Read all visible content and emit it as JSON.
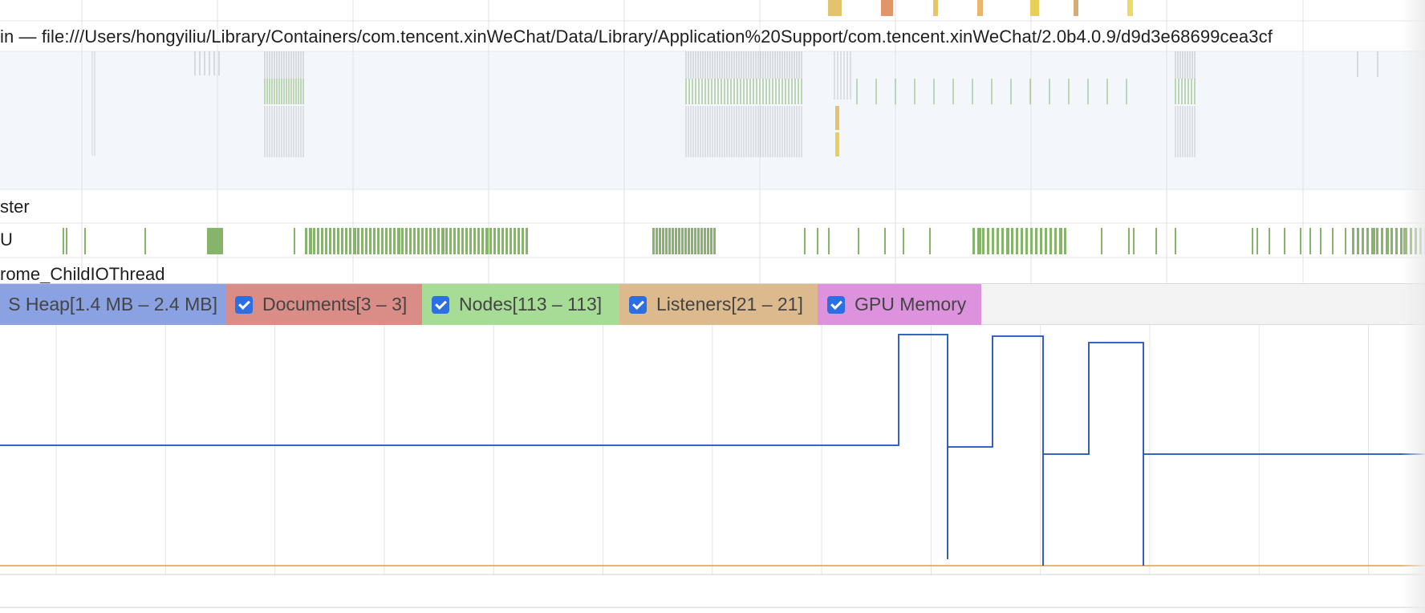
{
  "tracks": {
    "main_url": "in — file:///Users/hongyiliu/Library/Containers/com.tencent.xinWeChat/Data/Library/Application%20Support/com.tencent.xinWeChat/2.0b4.0.9/d9d3e68699cea3cf",
    "raster": "ster",
    "gpu": "U",
    "childio": "rome_ChildIOThread"
  },
  "counters": [
    {
      "key": "jsheap",
      "label": "S Heap[1.4 MB – 2.4 MB]",
      "checked": true,
      "color": "#8aa2e2"
    },
    {
      "key": "documents",
      "label": "Documents[3 – 3]",
      "checked": true,
      "color": "#da8d86"
    },
    {
      "key": "nodes",
      "label": "Nodes[113 – 113]",
      "checked": true,
      "color": "#a6dc96"
    },
    {
      "key": "listeners",
      "label": "Listeners[21 – 21]",
      "checked": true,
      "color": "#dcba8e"
    },
    {
      "key": "gpu",
      "label": "GPU Memory",
      "checked": true,
      "color": "#dc92dc"
    }
  ],
  "colors": {
    "jsheap_line": "#1f4fb5",
    "listeners_line": "#d7a24a",
    "gpu_activity": "#86b46a",
    "main_track_bg": "#f3f7fc"
  }
}
